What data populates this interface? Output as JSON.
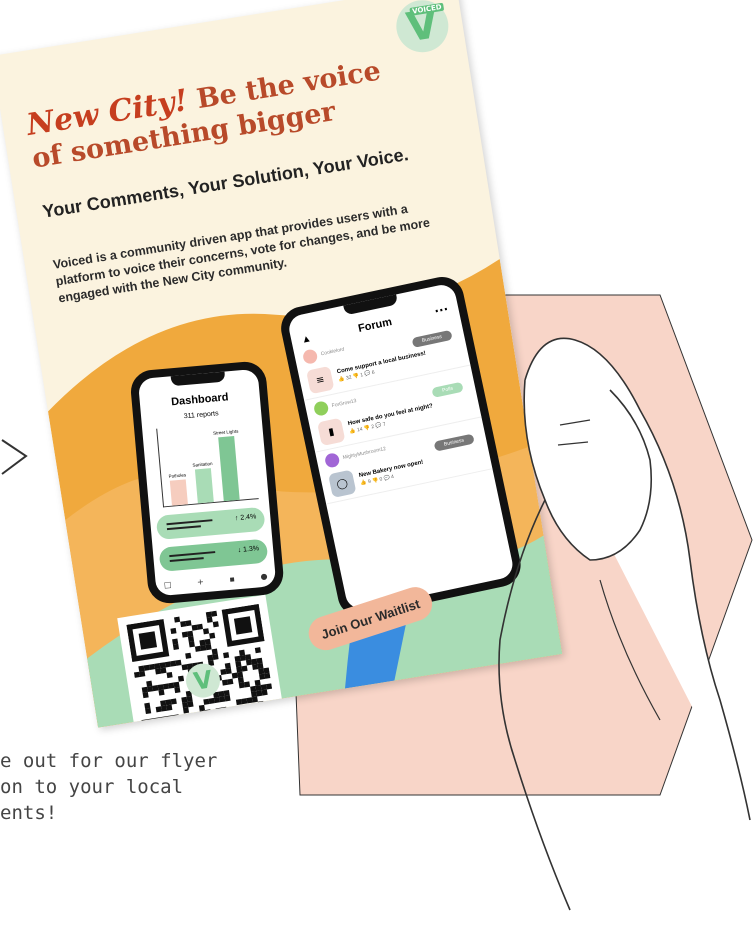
{
  "colors": {
    "hexagon": "#f8d5c8",
    "flyer_bg": "#fbf3df",
    "accent_orange": "#f0a93d",
    "accent_green": "#a9dcb6",
    "accent_blue": "#3a8de0",
    "headline_red": "#c63e1f"
  },
  "flyer": {
    "logo": "VOICED",
    "headline": {
      "accent": "New City!",
      "rest": " Be the voice of something bigger"
    },
    "subhead": "Your Comments, Your Solution, Your Voice.",
    "description": "Voiced is a community driven app that provides users with a platform to voice their concerns, vote for changes, and be more engaged with the New City community.",
    "button": "Join Our Waitlist"
  },
  "dashboard_phone": {
    "title": "Dashboard",
    "reports": "311 reports",
    "bar_labels": [
      "Potholes",
      "Sanitation",
      "Street Lights"
    ],
    "bar_values": [
      18,
      24,
      46
    ],
    "stat_up": "↑ 2.4%",
    "stat_down": "↓ 1.3%",
    "dock_icons": [
      "home-icon",
      "plus-icon",
      "chart-icon",
      "user-icon"
    ]
  },
  "forum_phone": {
    "title": "Forum",
    "posts": [
      {
        "user": "Cookielord",
        "tag": "Business",
        "title": "Come support a local business!",
        "meta": "👍 32  👎 1  💬 6"
      },
      {
        "user": "ForGrow13",
        "tag": "Polls",
        "title": "How safe do you feel at night?",
        "meta": "👍 14  👎 2  💬 7"
      },
      {
        "user": "MightyMushroom12",
        "tag": "Business",
        "title": "New Bakery now open!",
        "meta": "👍 9  👎 0  💬 4"
      }
    ]
  },
  "caption": "e out for our flyer\non to your local\nents!"
}
